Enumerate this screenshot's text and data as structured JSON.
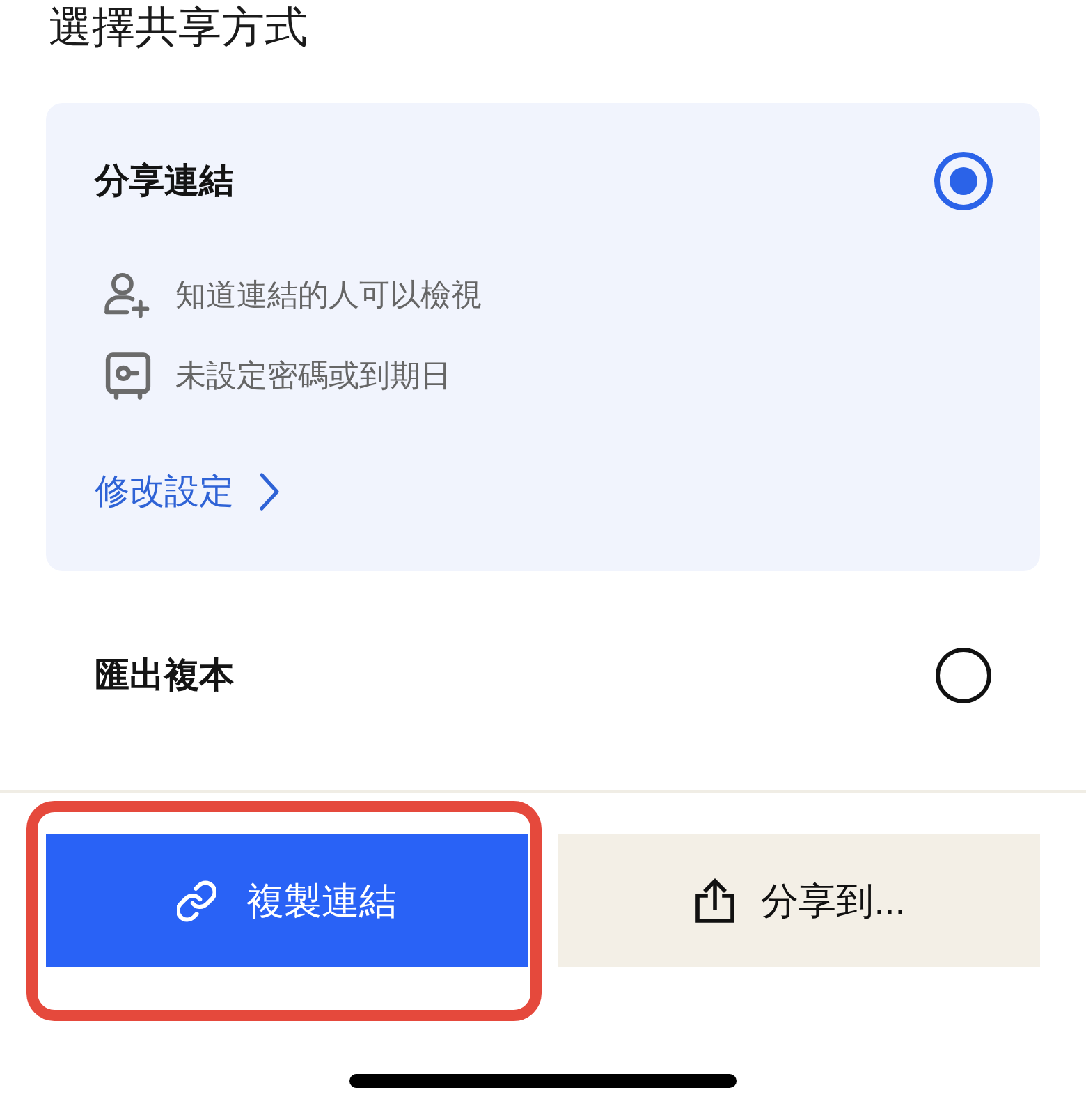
{
  "heading": "選擇共享方式",
  "options": [
    {
      "label": "分享連結",
      "selected": true,
      "details": [
        {
          "kind": "person",
          "text": "知道連結的人可以檢視"
        },
        {
          "kind": "safe",
          "text": "未設定密碼或到期日"
        }
      ],
      "link": "修改設定"
    },
    {
      "label": "匯出複本",
      "selected": false
    }
  ],
  "buttons": [
    {
      "kind": "primary",
      "label": "複製連結",
      "highlighted": true
    },
    {
      "kind": "secondary",
      "label": "分享到...",
      "highlighted": false
    }
  ]
}
